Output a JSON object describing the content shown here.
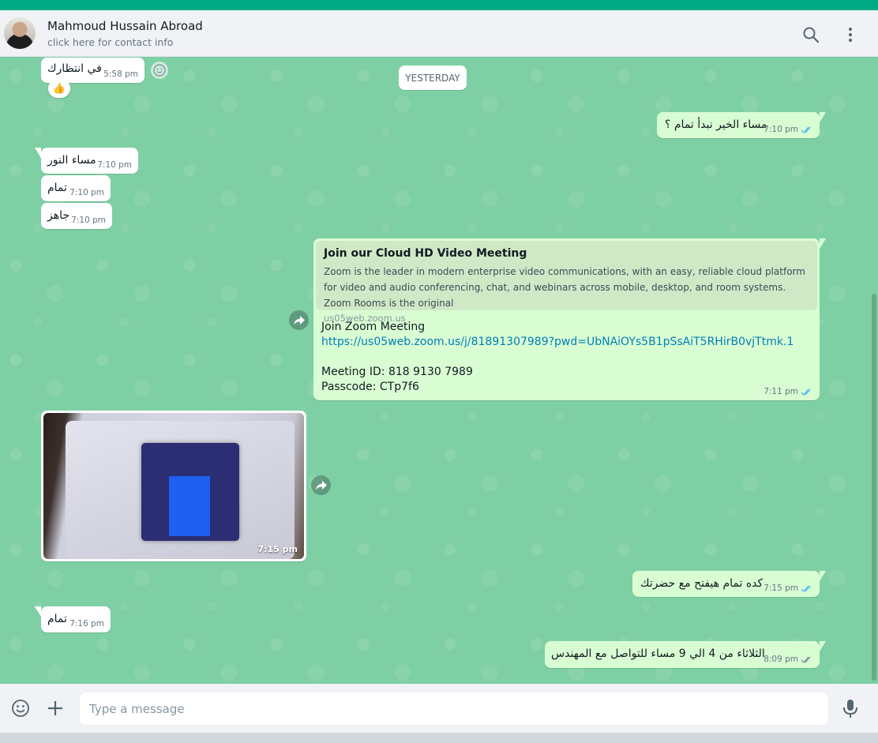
{
  "header": {
    "contact_name": "Mahmoud Hussain Abroad",
    "contact_subtitle": "click here for contact info",
    "icons": [
      "search-icon",
      "menu-icon"
    ]
  },
  "colors": {
    "accent": "#00a884",
    "chat_background": "#7fcfa4",
    "outgoing_bubble": "#d9fdd3",
    "incoming_bubble": "#ffffff",
    "read_ticks": "#53bdeb",
    "link": "#027eb5"
  },
  "day_divider": "YESTERDAY",
  "messages": [
    {
      "dir": "in",
      "text": "في انتظارك",
      "time": "5:58 pm",
      "reaction": "👍"
    },
    {
      "dir": "out",
      "text": "مساء الخير نبدأ تمام ؟",
      "time": "7:10 pm",
      "status": "read"
    },
    {
      "dir": "in",
      "text": "مساء النور",
      "time": "7:10 pm"
    },
    {
      "dir": "in",
      "text": "تمام",
      "time": "7:10 pm"
    },
    {
      "dir": "in",
      "text": "جاهز",
      "time": "7:10 pm"
    },
    {
      "dir": "out",
      "forwarded": true,
      "time": "7:11 pm",
      "status": "read",
      "preview": {
        "title": "Join our Cloud HD Video Meeting",
        "description": "Zoom is the leader in modern enterprise video communications, with an easy, reliable cloud platform for video and audio conferencing, chat, and webinars across mobile, desktop, and room systems. Zoom Rooms is the original",
        "host": "us05web.zoom.us"
      },
      "lines": [
        "Join Zoom Meeting",
        "https://us05web.zoom.us/j/81891307989?pwd=UbNAiOYs5B1pSsAiT5RHirB0vjTtmk.1",
        "",
        "Meeting ID: 818 9130 7989",
        "Passcode: CTp7f6"
      ]
    },
    {
      "dir": "in",
      "type": "image",
      "forwarded": true,
      "time": "7:15 pm"
    },
    {
      "dir": "out",
      "text": "كده تمام هيفتح مع حضرتك",
      "time": "7:15 pm",
      "status": "read"
    },
    {
      "dir": "in",
      "text": "تمام",
      "time": "7:16 pm"
    },
    {
      "dir": "out",
      "text": "الثلاثاء من 4 الي 9 مساء للتواصل مع المهندس",
      "time": "8:09 pm",
      "status": "delivered"
    }
  ],
  "composer": {
    "placeholder": "Type a message",
    "value": "",
    "icons": [
      "emoji-icon",
      "attach-plus-icon",
      "microphone-icon"
    ]
  }
}
